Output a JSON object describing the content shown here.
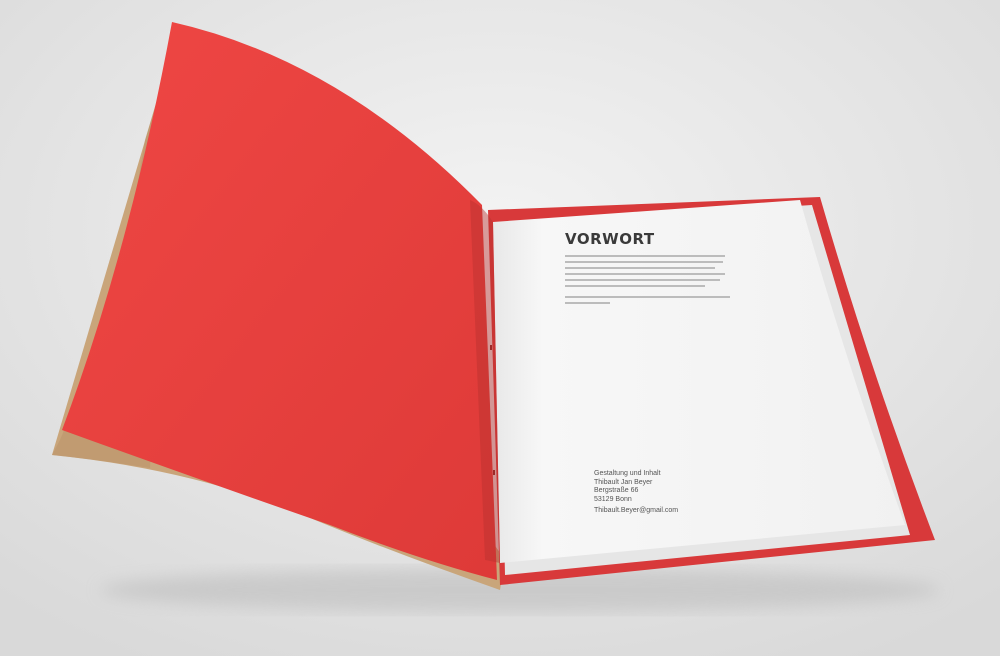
{
  "scene": {
    "colors": {
      "background": "#e4e4e4",
      "cover_red": "#e8403e",
      "cover_red_dark": "#c23230",
      "kraft_back": "#c9a57a",
      "paper": "#f5f5f5",
      "heading": "#3a3a3a"
    },
    "icons": [
      "booklet-illustration"
    ]
  },
  "page": {
    "heading": "VORWORT",
    "colophon": {
      "line1": "Gestaltung und Inhalt",
      "line2": "Thibault Jan Beyer",
      "line3": "Bergstraße 66",
      "line4": "53129 Bonn"
    },
    "email": "Thibault.Beyer@gmail.com"
  }
}
